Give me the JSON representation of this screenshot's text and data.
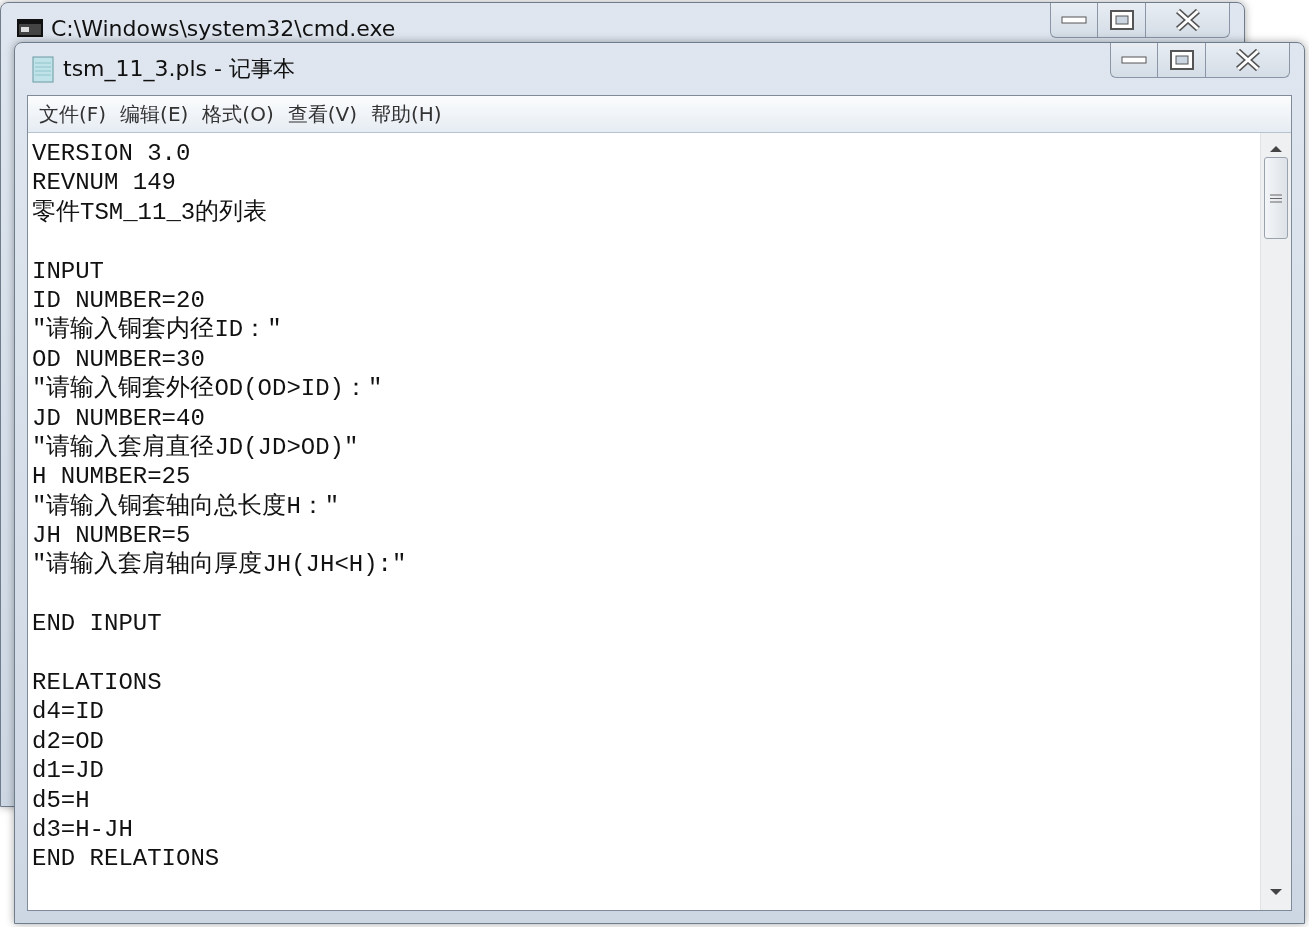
{
  "back_window": {
    "title": "C:\\Windows\\system32\\cmd.exe",
    "kind": "console"
  },
  "window": {
    "title": "tsm_11_3.pls - 记事本",
    "kind": "notepad"
  },
  "menu": [
    "文件(F)",
    "编辑(E)",
    "格式(O)",
    "查看(V)",
    "帮助(H)"
  ],
  "text_blocks": [
    [
      "VERSION 3.0",
      "REVNUM 149",
      "零件TSM_11_3的列表"
    ],
    [
      "INPUT",
      "ID NUMBER=20",
      "\"请输入铜套内径ID：\"",
      "OD NUMBER=30",
      "\"请输入铜套外径OD(OD>ID)：\"",
      "JD NUMBER=40",
      "\"请输入套肩直径JD(JD>OD)\"",
      "H NUMBER=25",
      "\"请输入铜套轴向总长度H：\"",
      "JH NUMBER=5",
      "\"请输入套肩轴向厚度JH(JH<H):\""
    ],
    [
      "END INPUT"
    ],
    [
      "RELATIONS",
      "d4=ID",
      "d2=OD",
      "d1=JD",
      "d5=H",
      "d3=H-JH",
      "END RELATIONS"
    ]
  ]
}
